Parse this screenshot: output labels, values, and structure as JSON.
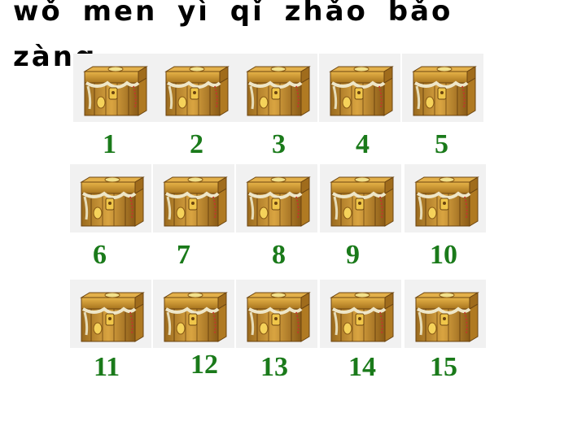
{
  "title": "wǒ men yì qǐ zhǎo bǎo zàng.",
  "number_color": "#1a7a1a",
  "chest_icon": "treasure-chest-icon",
  "rows": [
    {
      "numbers": [
        "1",
        "2",
        "3",
        "4",
        "5"
      ]
    },
    {
      "numbers": [
        "6",
        "7",
        "8",
        "9",
        "10"
      ]
    },
    {
      "numbers": [
        "11",
        "12",
        "13",
        "14",
        "15"
      ]
    }
  ]
}
